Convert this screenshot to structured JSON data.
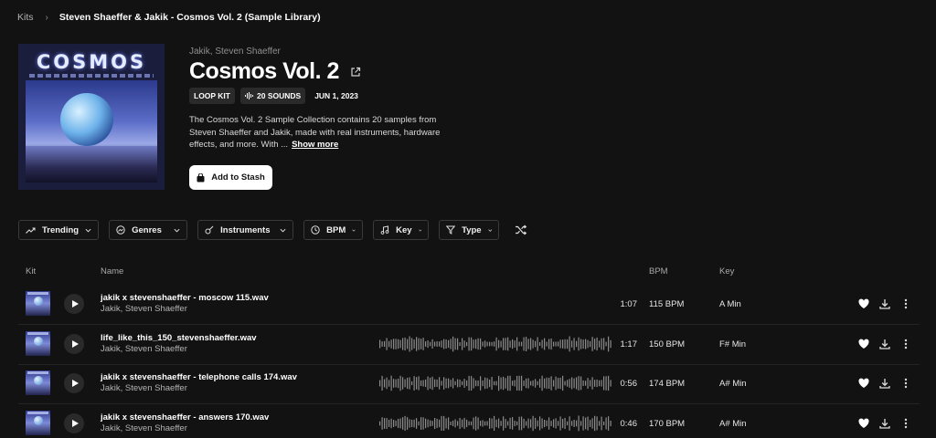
{
  "breadcrumb": {
    "root": "Kits",
    "separator": "›",
    "current": "Steven Shaeffer & Jakik - Cosmos Vol. 2 (Sample Library)"
  },
  "cover": {
    "title": "COSMOS",
    "play_icon": "play-icon"
  },
  "pack": {
    "artists": "Jakik, Steven Shaeffer",
    "title": "Cosmos Vol. 2",
    "external_link_icon": "external-link-icon",
    "badges": {
      "type": "LOOP KIT",
      "sounds": "20 SOUNDS",
      "date": "JUN 1, 2023"
    },
    "description": "The Cosmos Vol. 2 Sample Collection contains 20 samples from Steven Shaeffer and Jakik, made with real instruments, hardware effects, and more. With ...",
    "show_more": "Show more",
    "stash_button": "Add to Stash"
  },
  "filters": {
    "trending": "Trending",
    "genres": "Genres",
    "instruments": "Instruments",
    "bpm": "BPM",
    "key": "Key",
    "type": "Type"
  },
  "table": {
    "headers": {
      "kit": "Kit",
      "name": "Name",
      "bpm": "BPM",
      "key": "Key"
    },
    "rows": [
      {
        "name": "jakik x stevenshaeffer - moscow 115.wav",
        "artists": "Jakik, Steven Shaeffer",
        "duration": "1:07",
        "bpm": "115 BPM",
        "key": "A Min",
        "waveform": false
      },
      {
        "name": "life_like_this_150_stevenshaeffer.wav",
        "artists": "Jakik, Steven Shaeffer",
        "duration": "1:17",
        "bpm": "150 BPM",
        "key": "F# Min",
        "waveform": true
      },
      {
        "name": "jakik x stevenshaeffer - telephone calls 174.wav",
        "artists": "Jakik, Steven Shaeffer",
        "duration": "0:56",
        "bpm": "174 BPM",
        "key": "A# Min",
        "waveform": true
      },
      {
        "name": "jakik x stevenshaeffer - answers 170.wav",
        "artists": "Jakik, Steven Shaeffer",
        "duration": "0:46",
        "bpm": "170 BPM",
        "key": "A# Min",
        "waveform": true
      }
    ]
  },
  "colors": {
    "background": "#121212",
    "text_primary": "#ffffff",
    "text_secondary": "#b3b3b3",
    "waveform": "#8c8c8c"
  }
}
